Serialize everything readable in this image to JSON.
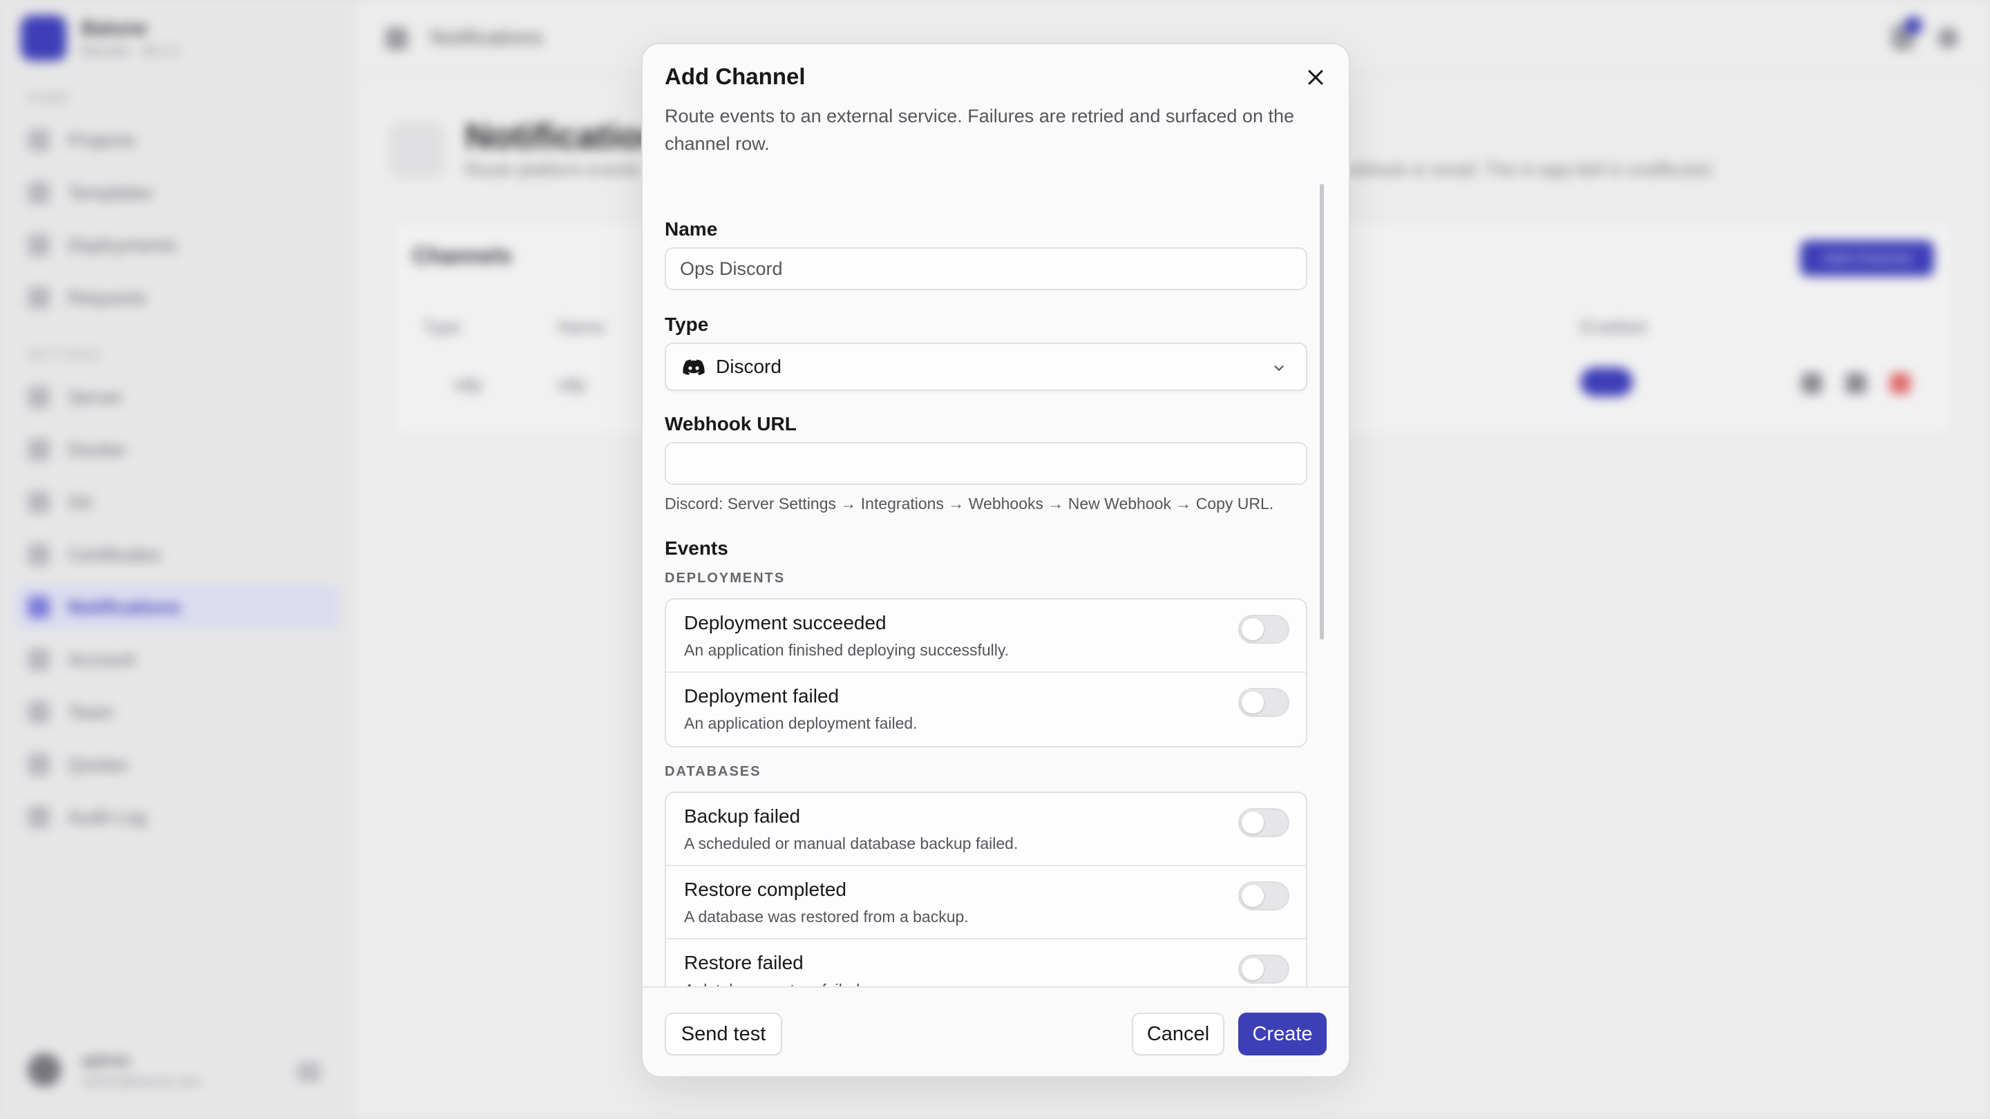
{
  "app": {
    "brand_name": "Batune",
    "brand_sub": "Bacuda  ·  v0.1.2",
    "nav_section_home": "HOME",
    "nav_section_settings": "SETTINGS",
    "nav_home": [
      "Projects",
      "Templates",
      "Deployments",
      "Requests"
    ],
    "nav_settings": [
      "Server",
      "Docker",
      "Git",
      "Certificates",
      "Notifications",
      "Account",
      "Team",
      "Quotas",
      "Audit Log"
    ],
    "active_nav": "Notifications",
    "user_name": "admin",
    "user_email": "admin@batune.dev",
    "topbar_title": "Notifications",
    "page_title": "Notifications",
    "page_desc": "Route platform events",
    "page_desc_tail": "ebhook or email. The in-app bell is unaffected.",
    "card_title": "Channels",
    "card_button": "Add Channel",
    "table_headers": [
      "Type",
      "Name",
      "Enabled"
    ],
    "table_row": [
      "ntfy",
      "ntfy"
    ]
  },
  "modal": {
    "title": "Add Channel",
    "description": "Route events to an external service. Failures are retried and surfaced on the channel row.",
    "name_label": "Name",
    "name_value": "Ops Discord",
    "type_label": "Type",
    "type_value": "Discord",
    "webhook_label": "Webhook URL",
    "webhook_value": "",
    "webhook_hint": "Discord: Server Settings → Integrations → Webhooks → New Webhook → Copy URL.",
    "events_label": "Events",
    "groups": [
      {
        "section": "DEPLOYMENTS",
        "events": [
          {
            "name": "Deployment succeeded",
            "desc": "An application finished deploying successfully.",
            "enabled": false
          },
          {
            "name": "Deployment failed",
            "desc": "An application deployment failed.",
            "enabled": false
          }
        ]
      },
      {
        "section": "DATABASES",
        "events": [
          {
            "name": "Backup failed",
            "desc": "A scheduled or manual database backup failed.",
            "enabled": false
          },
          {
            "name": "Restore completed",
            "desc": "A database was restored from a backup.",
            "enabled": false
          },
          {
            "name": "Restore failed",
            "desc": "A database restore failed.",
            "enabled": false
          }
        ]
      }
    ],
    "send_test_label": "Send test",
    "cancel_label": "Cancel",
    "create_label": "Create"
  },
  "colors": {
    "accent": "#3d3fb6",
    "overlay_background": "#e3e3e3",
    "toggle_off": "#e6e6e9"
  },
  "icons": [
    "discord-icon",
    "close-icon",
    "chevron-down-icon"
  ]
}
